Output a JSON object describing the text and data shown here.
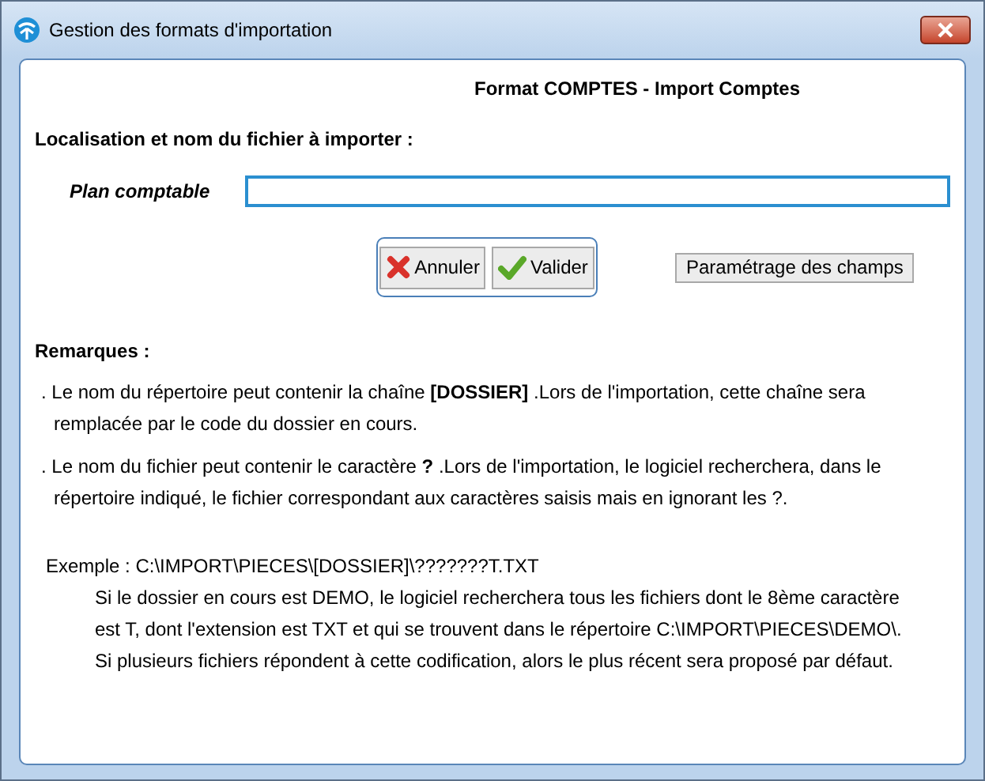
{
  "window": {
    "title": "Gestion des formats d'importation"
  },
  "format_title": "Format COMPTES - Import Comptes",
  "location_label": "Localisation et nom du fichier à importer :",
  "field": {
    "label": "Plan comptable"
  },
  "buttons": [
    {
      "kind": "cancel",
      "label": "Annuler"
    },
    {
      "kind": "ok",
      "label": "Valider"
    }
  ],
  "settings_button": "Paramétrage des champs",
  "remarks": {
    "title": "Remarques :",
    "items": [
      ". Le nom du répertoire peut contenir la chaîne  **[DOSSIER]** .Lors de l'importation, cette chaîne sera remplacée par le code du dossier en cours.",
      ". Le nom du fichier peut contenir le caractère  **?** .Lors de l'importation, le logiciel recherchera, dans le répertoire indiqué, le fichier correspondant aux caractères saisis mais en ignorant les ?."
    ]
  },
  "example": {
    "label": "Exemple : C:\\IMPORT\\PIECES\\[DOSSIER]\\???????T.TXT",
    "lines": [
      "Si le dossier en cours est DEMO, le logiciel recherchera tous les fichiers dont le 8ème caractère",
      "est T, dont l'extension est TXT et qui se trouvent dans le répertoire C:\\IMPORT\\PIECES\\DEMO\\.",
      "Si plusieurs fichiers répondent à cette codification, alors le plus récent sera proposé par défaut."
    ]
  }
}
